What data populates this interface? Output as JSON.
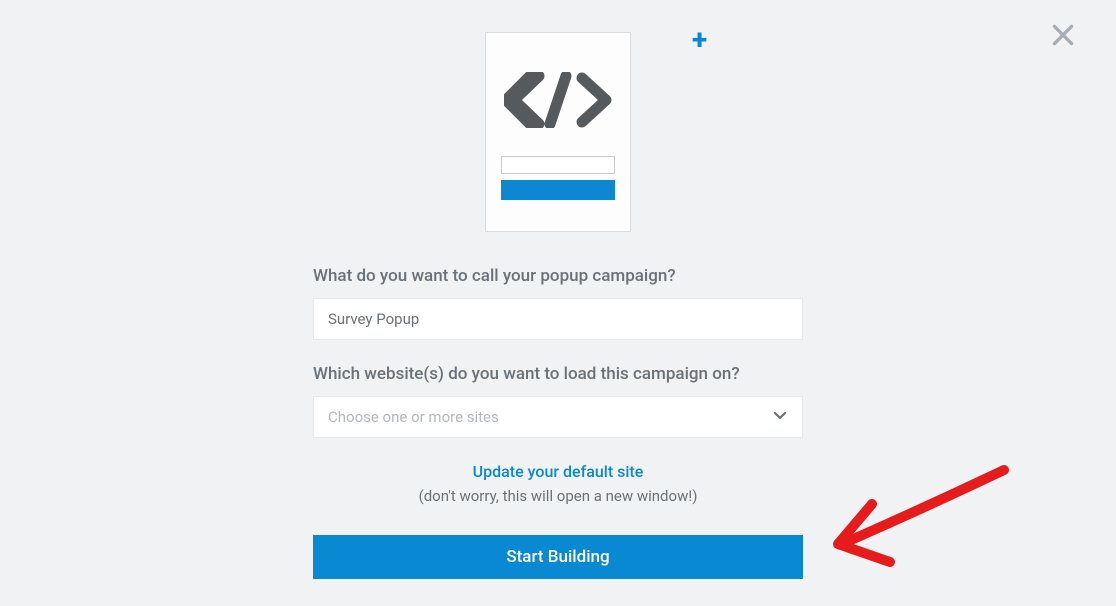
{
  "modal": {
    "campaign_name_label": "What do you want to call your popup campaign?",
    "campaign_name_value": "Survey Popup",
    "website_label": "Which website(s) do you want to load this campaign on?",
    "website_placeholder": "Choose one or more sites",
    "update_link": "Update your default site",
    "update_note": "(don't worry, this will open a new window!)",
    "start_button": "Start Building"
  },
  "colors": {
    "accent": "#0a89d3",
    "background": "#f0f2f3",
    "text_muted": "#6a7177",
    "placeholder": "#b4b9bd",
    "annotation": "#e61b1b"
  }
}
